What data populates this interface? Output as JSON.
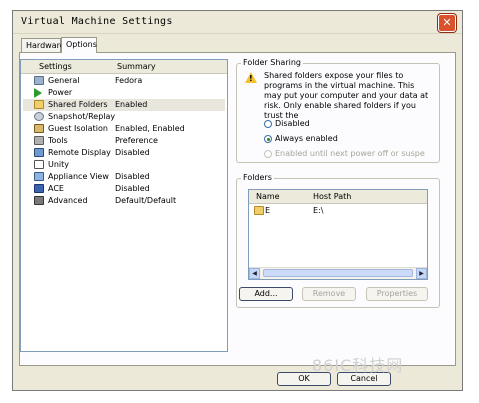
{
  "window": {
    "title": "Virtual Machine Settings"
  },
  "tabs": [
    {
      "label": "Hardware"
    },
    {
      "label": "Options"
    }
  ],
  "settings_list": {
    "headers": {
      "settings": "Settings",
      "summary": "Summary"
    },
    "rows": [
      {
        "name": "General",
        "summary": "Fedora",
        "icon": "general-icon"
      },
      {
        "name": "Power",
        "summary": "",
        "icon": "power-icon"
      },
      {
        "name": "Shared Folders",
        "summary": "Enabled",
        "icon": "folder-icon",
        "selected": true
      },
      {
        "name": "Snapshot/Replay",
        "summary": "",
        "icon": "snapshot-icon"
      },
      {
        "name": "Guest Isolation",
        "summary": "Enabled, Enabled",
        "icon": "lock-icon"
      },
      {
        "name": "Tools",
        "summary": "Preference",
        "icon": "tools-icon"
      },
      {
        "name": "Remote Display",
        "summary": "Disabled",
        "icon": "remote-display-icon"
      },
      {
        "name": "Unity",
        "summary": "",
        "icon": "unity-icon"
      },
      {
        "name": "Appliance View",
        "summary": "Disabled",
        "icon": "appliance-icon"
      },
      {
        "name": "ACE",
        "summary": "Disabled",
        "icon": "ace-icon"
      },
      {
        "name": "Advanced",
        "summary": "Default/Default",
        "icon": "advanced-icon"
      }
    ]
  },
  "folder_sharing": {
    "label": "Folder Sharing",
    "description": "Shared folders expose your files to programs in the virtual machine. This may put your computer and your data at risk. Only enable shared folders if you trust the",
    "options": [
      {
        "label": "Disabled",
        "checked": false,
        "enabled": true
      },
      {
        "label": "Always enabled",
        "checked": true,
        "enabled": true
      },
      {
        "label": "Enabled until next power off or suspe",
        "checked": false,
        "enabled": false
      }
    ]
  },
  "folders": {
    "label": "Folders",
    "headers": {
      "name": "Name",
      "host_path": "Host Path"
    },
    "rows": [
      {
        "name": "E",
        "host_path": "E:\\"
      }
    ],
    "buttons": {
      "add": "Add...",
      "remove": "Remove",
      "properties": "Properties"
    }
  },
  "footer": {
    "ok": "OK",
    "cancel": "Cancel"
  },
  "watermark": "86IC科技网"
}
